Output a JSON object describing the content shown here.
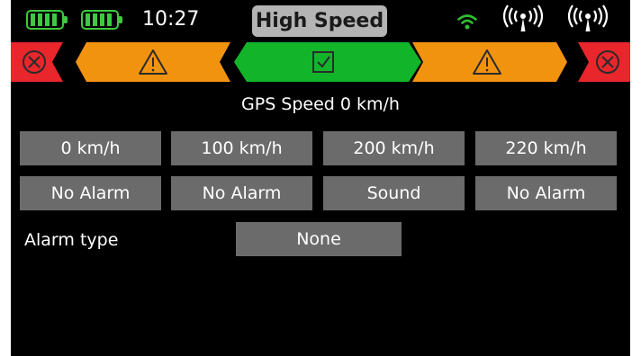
{
  "status_bar": {
    "time": "10:27",
    "mode_title": "High Speed",
    "icons": [
      "battery-icon",
      "battery-icon",
      "wifi-icon",
      "antenna-icon",
      "antenna-icon"
    ],
    "battery_color": "#3fc93f",
    "wifi_color": "#2fbf2f"
  },
  "zones": {
    "icons": [
      "close-icon",
      "warning-icon",
      "checkbox-icon",
      "warning-icon",
      "close-icon"
    ],
    "colors": {
      "danger": "#e8262b",
      "warning": "#f2930f",
      "ok": "#12b52a"
    }
  },
  "gps": {
    "text": "GPS  Speed 0 km/h"
  },
  "speed_thresholds": [
    "0 km/h",
    "100 km/h",
    "200 km/h",
    "220 km/h"
  ],
  "alarms": [
    "No Alarm",
    "No Alarm",
    "Sound",
    "No Alarm"
  ],
  "alarm_type": {
    "label": "Alarm type",
    "value": "None"
  }
}
